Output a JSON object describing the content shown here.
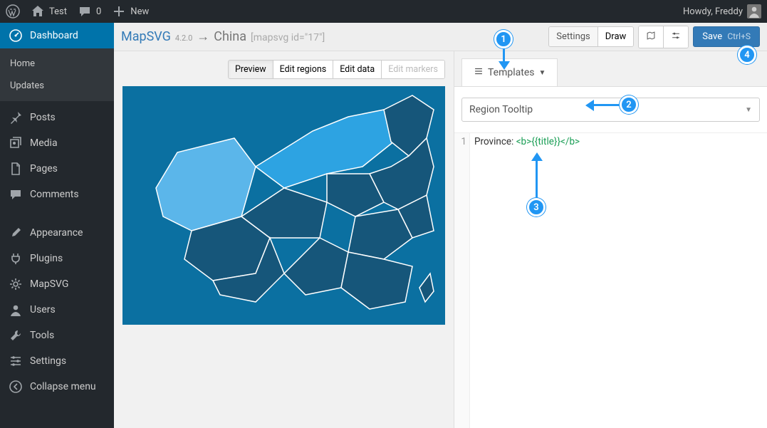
{
  "adminBar": {
    "site": "Test",
    "comments": "0",
    "new": "New",
    "howdy": "Howdy, Freddy"
  },
  "sidebar": {
    "dashboard": "Dashboard",
    "home": "Home",
    "updates": "Updates",
    "posts": "Posts",
    "media": "Media",
    "pages": "Pages",
    "comments": "Comments",
    "appearance": "Appearance",
    "plugins": "Plugins",
    "mapsvg": "MapSVG",
    "users": "Users",
    "tools": "Tools",
    "settings": "Settings",
    "collapse": "Collapse menu"
  },
  "breadcrumb": {
    "app": "MapSVG",
    "version": "4.2.0",
    "arrow": "→",
    "map": "China",
    "shortcode": "[mapsvg id=\"17\"]"
  },
  "topbarButtons": {
    "settings": "Settings",
    "draw": "Draw",
    "save": "Save",
    "saveHint": "Ctrl+S"
  },
  "mapToolbar": {
    "preview": "Preview",
    "editRegions": "Edit regions",
    "editData": "Edit data",
    "editMarkers": "Edit markers"
  },
  "rightPanel": {
    "tab": "Templates",
    "selectValue": "Region Tooltip"
  },
  "editor": {
    "line1no": "1",
    "line1_prefix": "Province: ",
    "line1_open": "<b>",
    "line1_var": "{{title}}",
    "line1_close": "</b>"
  },
  "annotations": {
    "b1": "1",
    "b2": "2",
    "b3": "3",
    "b4": "4"
  }
}
